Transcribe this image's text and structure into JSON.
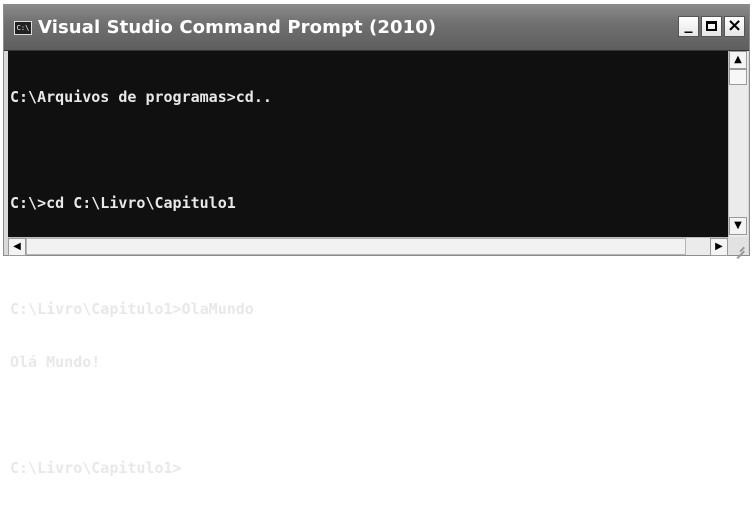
{
  "window": {
    "title": "Visual Studio Command Prompt (2010)",
    "icon_label": "C:\\",
    "controls": {
      "minimize": "_",
      "maximize": "□",
      "close": "×"
    }
  },
  "console": {
    "lines": [
      "C:\\Arquivos de programas>cd..",
      "",
      "C:\\>cd C:\\Livro\\Capitulo1",
      "",
      "C:\\Livro\\Capitulo1>OlaMundo",
      "Olá Mundo!",
      "",
      "C:\\Livro\\Capitulo1>"
    ]
  },
  "scrollbars": {
    "up_arrow": "▲",
    "down_arrow": "▼",
    "left_arrow": "◀",
    "right_arrow": "▶"
  },
  "colors": {
    "console_bg": "#101010",
    "console_text": "#e8e8e8",
    "titlebar": "#707070"
  }
}
